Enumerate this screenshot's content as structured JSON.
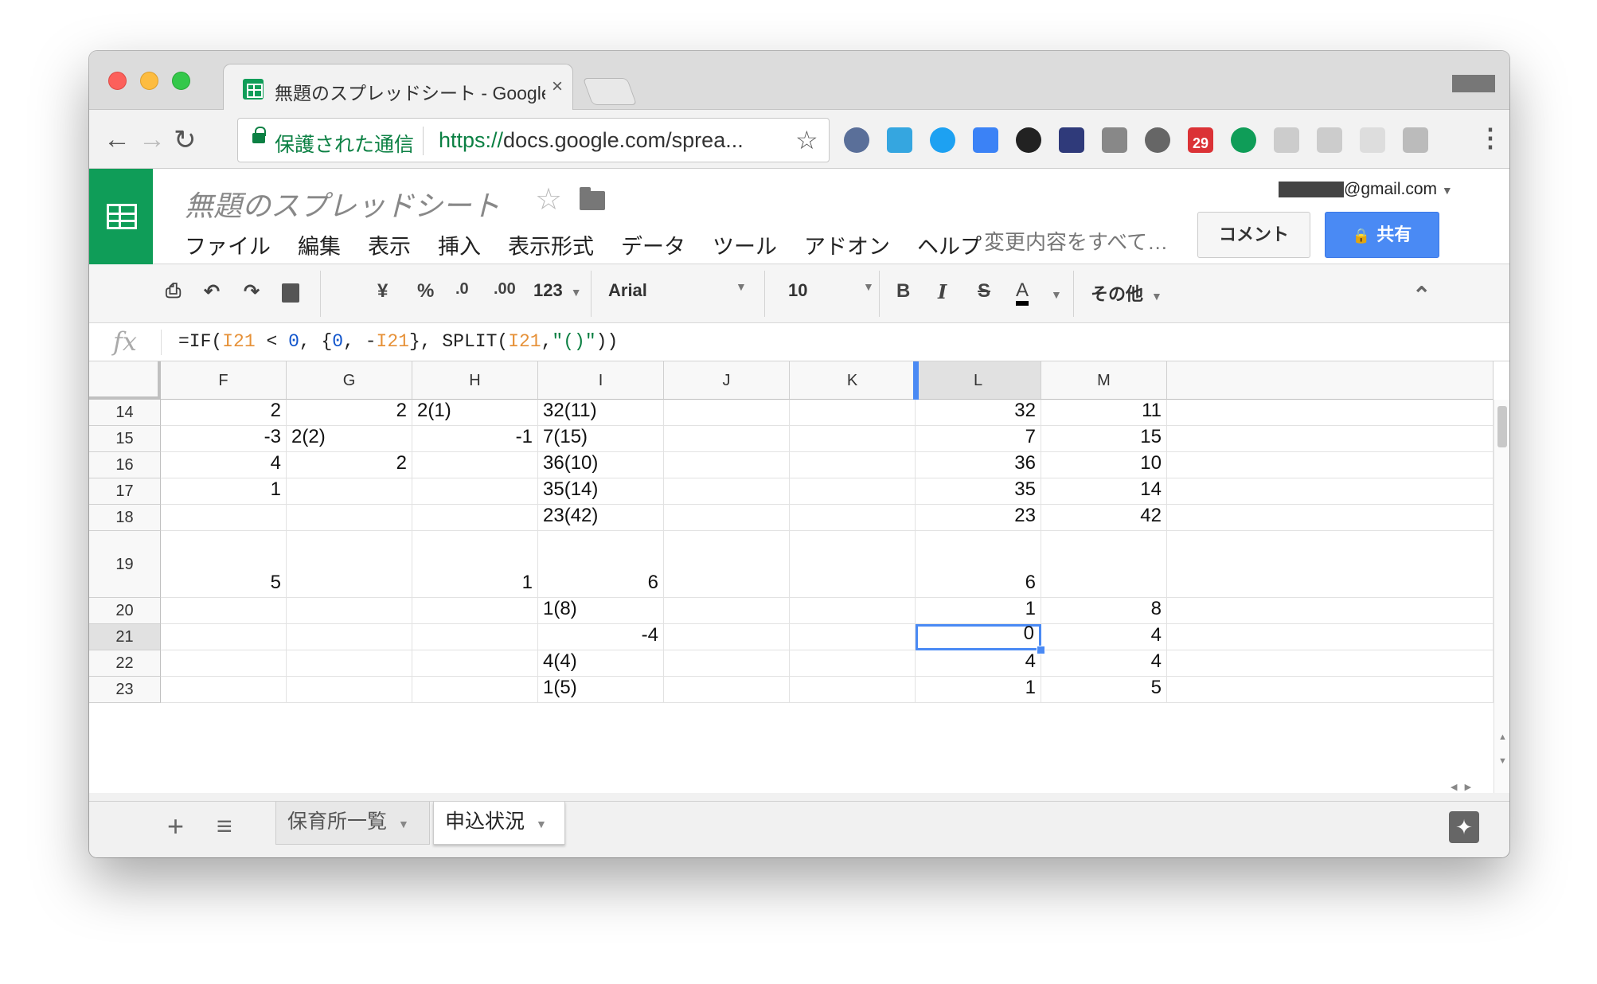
{
  "browser": {
    "tab_title": "無題のスプレッドシート - Google",
    "tab_close": "×",
    "secure_label": "保護された通信",
    "url_scheme": "https://",
    "url_rest": "docs.google.com/sprea...",
    "bookmark_star": "☆",
    "back": "←",
    "forward": "→",
    "reload": "↻",
    "menu": "⋮",
    "ext_badge": "29"
  },
  "app": {
    "doc_title": "無題のスプレッドシート",
    "title_star": "☆",
    "menus": [
      "ファイル",
      "編集",
      "表示",
      "挿入",
      "表示形式",
      "データ",
      "ツール",
      "アドオン",
      "ヘルプ"
    ],
    "changes_saved": "変更内容をすべて…",
    "account": "@gmail.com",
    "comment_button": "コメント",
    "share_button": "共有"
  },
  "format_toolbar": {
    "print": "⎙",
    "undo": "↶",
    "redo": "↷",
    "currency": "¥",
    "percent": "%",
    "dec_less": ".0",
    "dec_more": ".00",
    "num_format": "123",
    "font": "Arial",
    "size": "10",
    "bold": "B",
    "italic": "I",
    "strike": "S",
    "text_color": "A",
    "more": "その他",
    "collapse": "⌃"
  },
  "formula_bar": {
    "fx": "fx",
    "parts": [
      {
        "t": "=IF(",
        "c": ""
      },
      {
        "t": "I21",
        "c": "r"
      },
      {
        "t": " < ",
        "c": ""
      },
      {
        "t": "0",
        "c": "n"
      },
      {
        "t": ", {",
        "c": ""
      },
      {
        "t": "0",
        "c": "n"
      },
      {
        "t": ", -",
        "c": ""
      },
      {
        "t": "I21",
        "c": "r"
      },
      {
        "t": "}, SPLIT(",
        "c": ""
      },
      {
        "t": "I21",
        "c": "r"
      },
      {
        "t": ",",
        "c": ""
      },
      {
        "t": "\"()\"",
        "c": "st"
      },
      {
        "t": "))",
        "c": ""
      }
    ]
  },
  "grid": {
    "columns": [
      "F",
      "G",
      "H",
      "I",
      "J",
      "K",
      "L",
      "M"
    ],
    "selected_column": "L",
    "selected_row": "21",
    "rows": [
      {
        "label": "14",
        "cells": [
          "2",
          "2",
          "2(1)",
          "32(11)",
          "",
          "",
          "32",
          "11"
        ]
      },
      {
        "label": "15",
        "cells": [
          "-3",
          "2(2)",
          "-1",
          "7(15)",
          "",
          "",
          "7",
          "15"
        ]
      },
      {
        "label": "16",
        "cells": [
          "4",
          "2",
          "",
          "36(10)",
          "",
          "",
          "36",
          "10"
        ]
      },
      {
        "label": "17",
        "cells": [
          "1",
          "",
          "",
          "35(14)",
          "",
          "",
          "35",
          "14"
        ]
      },
      {
        "label": "18",
        "cells": [
          "",
          "",
          "",
          "23(42)",
          "",
          "",
          "23",
          "42"
        ]
      },
      {
        "label": "19",
        "cells": [
          "5",
          "",
          "1",
          "6",
          "",
          "",
          "6",
          ""
        ]
      },
      {
        "label": "20",
        "cells": [
          "",
          "",
          "",
          "1(8)",
          "",
          "",
          "1",
          "8"
        ]
      },
      {
        "label": "21",
        "cells": [
          "",
          "",
          "",
          "-4",
          "",
          "",
          "0",
          "4"
        ]
      },
      {
        "label": "22",
        "cells": [
          "",
          "",
          "",
          "4(4)",
          "",
          "",
          "4",
          "4"
        ]
      },
      {
        "label": "23",
        "cells": [
          "",
          "",
          "",
          "1(5)",
          "",
          "",
          "1",
          "5"
        ]
      }
    ]
  },
  "sheets": {
    "add": "+",
    "list": "≡",
    "tabs": [
      {
        "label": "保育所一覧",
        "active": false
      },
      {
        "label": "申込状況",
        "active": true
      }
    ],
    "explore": "✦"
  },
  "colors": {
    "sheets_green": "#0f9d58",
    "share_blue": "#4a8af4",
    "selection": "#4a8af4"
  }
}
